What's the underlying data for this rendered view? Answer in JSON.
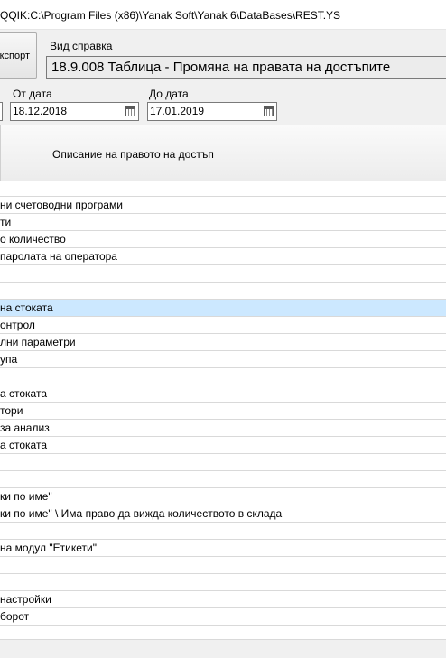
{
  "window": {
    "title": "QQIK:C:\\Program Files (x86)\\Yanak Soft\\Yanak 6\\DataBases\\REST.YS"
  },
  "toolbar": {
    "export_label": "кспорт",
    "report_type_label": "Вид справка",
    "report_type_value": "18.9.008 Таблица - Промяна на правата на достъпите"
  },
  "filters": {
    "from_label": "От дата",
    "from_value": "18.12.2018",
    "to_label": "До дата",
    "to_value": "17.01.2019"
  },
  "grid": {
    "header": "Описание на правото на достъп",
    "selected_index": 7,
    "rows": [
      "",
      "ни счетоводни програми",
      "ти",
      "о количество",
      "паролата на оператора",
      "",
      "",
      "на стоката",
      "онтрол",
      "лни параметри",
      "упа",
      "",
      "а стоката",
      "тори",
      " за анализ",
      "а стоката",
      "",
      "",
      "ки по име\"",
      "ки по име\" \\ Има право да вижда количеството в склада",
      "",
      "на модул \"Етикети\"",
      "",
      "",
      " настройки",
      "борот",
      ""
    ]
  }
}
